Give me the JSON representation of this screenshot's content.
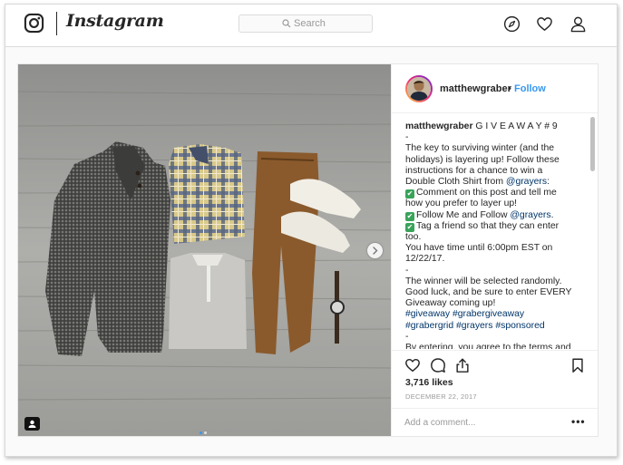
{
  "app": {
    "brand": "Instagram"
  },
  "nav": {
    "search_placeholder": "Search"
  },
  "post": {
    "author": "matthewgraber",
    "separator": "•",
    "follow_label": "Follow",
    "caption_lines": [
      [
        {
          "t": "matthewgraber",
          "k": "user"
        },
        {
          "t": " G I V E A W A Y # 9"
        }
      ],
      [
        {
          "t": "-"
        }
      ],
      [
        {
          "t": "The key to surviving winter (and the"
        }
      ],
      [
        {
          "t": "holidays) is layering up! Follow these"
        }
      ],
      [
        {
          "t": "instructions for a chance to win a"
        }
      ],
      [
        {
          "t": "Double Cloth Shirt from "
        },
        {
          "t": "@grayers",
          "k": "link"
        },
        {
          "t": ":"
        }
      ],
      [
        {
          "t": "✔",
          "k": "check"
        },
        {
          "t": "Comment on this post and tell me"
        }
      ],
      [
        {
          "t": "how you prefer to layer up!"
        }
      ],
      [
        {
          "t": "✔",
          "k": "check"
        },
        {
          "t": "Follow Me and Follow "
        },
        {
          "t": "@grayers",
          "k": "link"
        },
        {
          "t": "."
        }
      ],
      [
        {
          "t": "✔",
          "k": "check"
        },
        {
          "t": "Tag a friend so that they can enter"
        }
      ],
      [
        {
          "t": "too."
        }
      ],
      [
        {
          "t": "You have time until 6:00pm EST on"
        }
      ],
      [
        {
          "t": "12/22/17."
        }
      ],
      [
        {
          "t": "-"
        }
      ],
      [
        {
          "t": "The winner will be selected randomly."
        }
      ],
      [
        {
          "t": "Good luck, and be sure to enter EVERY"
        }
      ],
      [
        {
          "t": "Giveaway coming up!"
        }
      ],
      [
        {
          "t": "#giveaway",
          "k": "link"
        },
        {
          "t": " "
        },
        {
          "t": "#grabergiveaway",
          "k": "link"
        }
      ],
      [
        {
          "t": "#grabergrid",
          "k": "link"
        },
        {
          "t": " "
        },
        {
          "t": "#grayers",
          "k": "link"
        },
        {
          "t": " "
        },
        {
          "t": "#sponsored",
          "k": "link"
        }
      ],
      [
        {
          "t": "-"
        }
      ],
      [
        {
          "t": "By entering, you agree to the terms and"
        }
      ]
    ],
    "likes": "3,716 likes",
    "date": "DECEMBER 22, 2017",
    "comment_placeholder": "Add a comment...",
    "more_label": "•••"
  },
  "colors": {
    "link_blue": "#3897f0",
    "hashtag": "#003569",
    "text": "#262626",
    "muted": "#999999",
    "check_green": "#3aa35a"
  },
  "icons": {
    "nav": [
      "instagram-logo-icon",
      "compass-icon",
      "heart-icon",
      "profile-icon"
    ],
    "actions": [
      "like-heart-icon",
      "comment-icon",
      "share-icon",
      "bookmark-icon"
    ],
    "photo": [
      "carousel-next-icon",
      "tagged-user-icon"
    ]
  },
  "carousel": {
    "slides": 2,
    "active_slide": 1
  }
}
